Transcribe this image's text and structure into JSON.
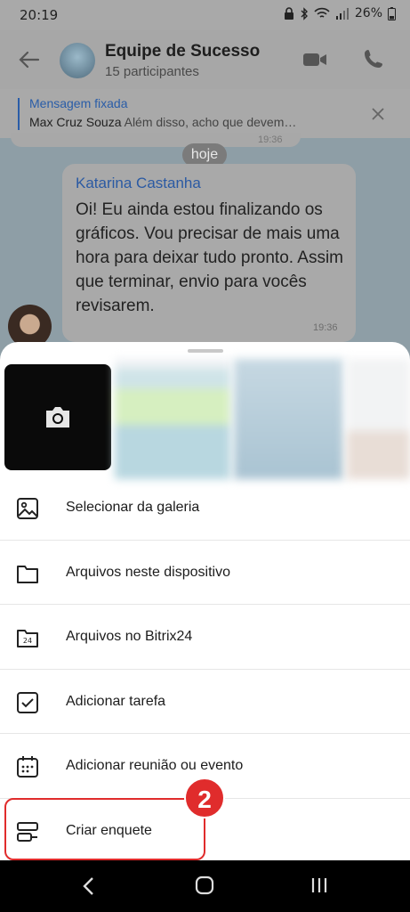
{
  "status_bar": {
    "time": "20:19",
    "battery": "26%"
  },
  "header": {
    "title": "Equipe de Sucesso",
    "subtitle": "15 participantes"
  },
  "pinned": {
    "label": "Mensagem fixada",
    "author": "Max Cruz Souza",
    "text": "Além disso, acho que devem…"
  },
  "chat": {
    "previous_time": "19:36",
    "day_separator": "hoje",
    "message": {
      "author": "Katarina Castanha",
      "text": "Oi! Eu ainda estou finalizando os gráficos. Vou precisar de mais uma hora para deixar tudo pronto. Assim que terminar, envio para vocês revisarem.",
      "time": "19:36"
    }
  },
  "sheet": {
    "items": [
      {
        "label": "Selecionar da galeria",
        "icon": "image-icon"
      },
      {
        "label": "Arquivos neste dispositivo",
        "icon": "folder-icon"
      },
      {
        "label": "Arquivos no Bitrix24",
        "icon": "bitrix-folder-icon"
      },
      {
        "label": "Adicionar tarefa",
        "icon": "task-checkbox-icon"
      },
      {
        "label": "Adicionar reunião ou evento",
        "icon": "calendar-icon"
      },
      {
        "label": "Criar enquete",
        "icon": "poll-icon"
      }
    ]
  },
  "annotation": {
    "step": "2",
    "color": "#e02c2c"
  }
}
